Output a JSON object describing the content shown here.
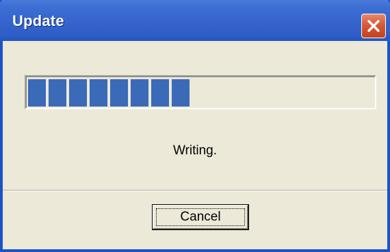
{
  "window": {
    "title": "Update",
    "colors": {
      "titlebar": "#3565cc",
      "frame": "#1a53c8",
      "dialog_bg": "#ece9d8",
      "progress_block": "#3b6ab8",
      "close_button": "#d7593a"
    }
  },
  "close_button": {
    "icon": "close-icon"
  },
  "progress": {
    "value": 0.48,
    "segments_filled": 8
  },
  "status": {
    "text": "Writing."
  },
  "buttons": {
    "cancel_label": "Cancel"
  }
}
